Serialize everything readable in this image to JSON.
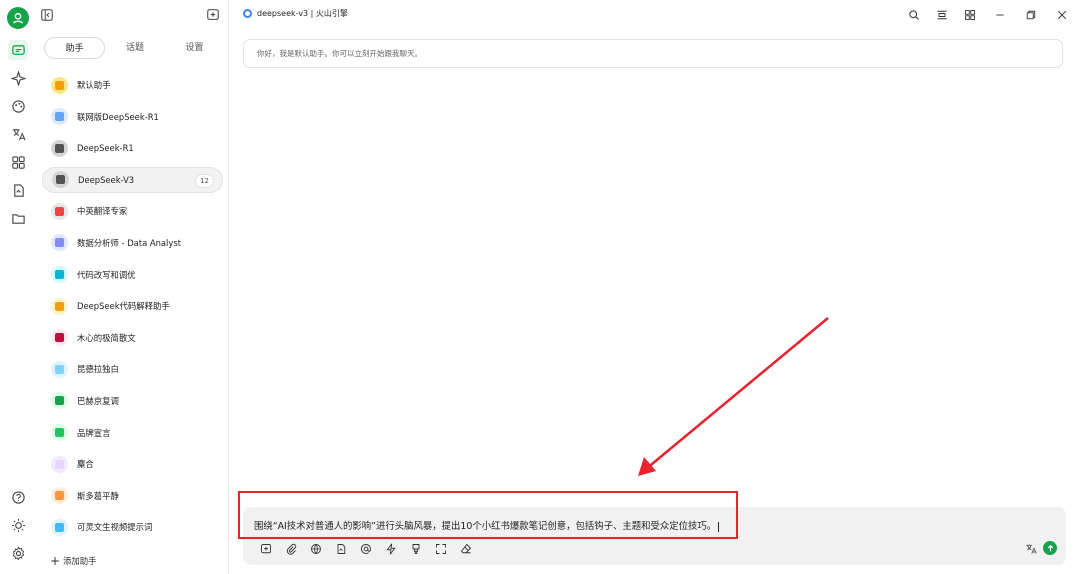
{
  "header": {
    "model_title": "deepseek-v3 | 火山引擎"
  },
  "sidebar": {
    "tabs": [
      "助手",
      "话题",
      "设置"
    ],
    "active_tab": 0,
    "items": [
      {
        "label": "默认助手",
        "icon": "star-icon",
        "color": "#fde68a",
        "inner": "#f59e0b"
      },
      {
        "label": "联网版DeepSeek-R1",
        "icon": "globe-icon",
        "color": "#dbeafe",
        "inner": "#60a5fa"
      },
      {
        "label": "DeepSeek-R1",
        "icon": "robot-icon",
        "color": "#d4d4d4",
        "inner": "#525252"
      },
      {
        "label": "DeepSeek-V3",
        "icon": "robot-icon",
        "color": "#d4d4d4",
        "inner": "#525252",
        "badge": "12"
      },
      {
        "label": "中英翻译专家",
        "icon": "books-icon",
        "color": "#e5e7eb",
        "inner": "#ef4444"
      },
      {
        "label": "数据分析师 - Data Analyst",
        "icon": "chart-icon",
        "color": "#e0e7ff",
        "inner": "#818cf8"
      },
      {
        "label": "代码改写和调优",
        "icon": "monitor-icon",
        "color": "#cffafe",
        "inner": "#06b6d4"
      },
      {
        "label": "DeepSeek代码解释助手",
        "icon": "face-icon",
        "color": "#fef3c7",
        "inner": "#f59e0b"
      },
      {
        "label": "木心的极简散文",
        "icon": "book-icon",
        "color": "#fce7f3",
        "inner": "#be123c"
      },
      {
        "label": "昆德拉独白",
        "icon": "open-book-icon",
        "color": "#e0f2fe",
        "inner": "#7dd3fc"
      },
      {
        "label": "巴赫京复调",
        "icon": "green-book-icon",
        "color": "#dcfce7",
        "inner": "#16a34a"
      },
      {
        "label": "品牌宣言",
        "icon": "image-icon",
        "color": "#dcfce7",
        "inner": "#22c55e"
      },
      {
        "label": "麋合",
        "icon": "bubble-icon",
        "color": "#f3e8ff",
        "inner": "#e9d5ff"
      },
      {
        "label": "斯多葛平静",
        "icon": "person-icon",
        "color": "#ffedd5",
        "inner": "#fb923c"
      },
      {
        "label": "可灵文生视频提示词",
        "icon": "screen-icon",
        "color": "#e0f2fe",
        "inner": "#38bdf8"
      }
    ],
    "add_label": "添加助手"
  },
  "chat": {
    "welcome": "你好，我是默认助手。你可以立刻开始跟我聊天。"
  },
  "input": {
    "text": "围绕“AI技术对普通人的影响”进行头脑风暴，提出10个小红书爆款笔记创意，包括钩子、主题和受众定位技巧。"
  },
  "colors": {
    "accent": "#16a34a",
    "highlight": "#e8232d"
  }
}
